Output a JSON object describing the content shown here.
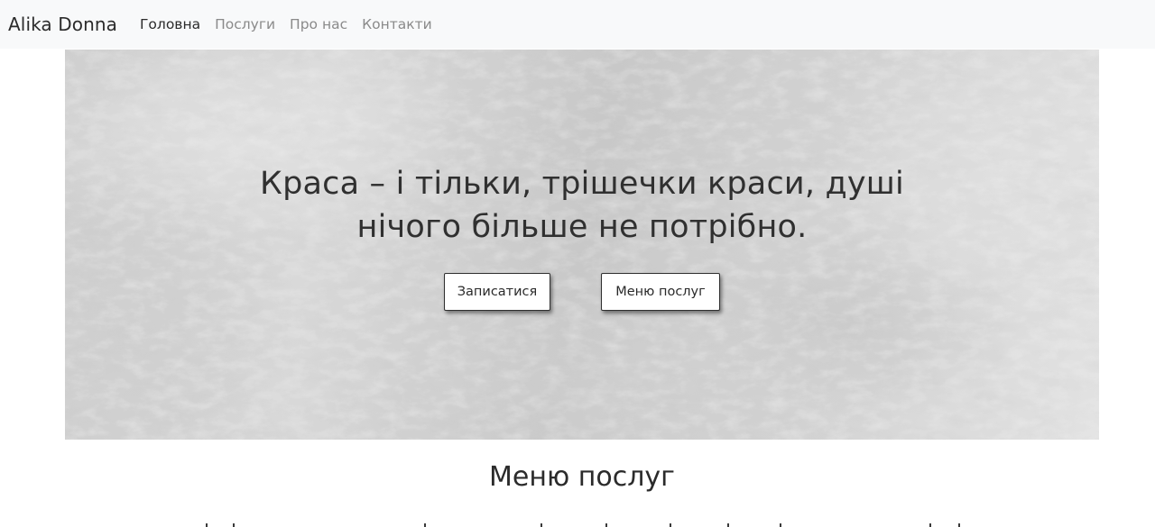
{
  "navbar": {
    "brand": "Alika Donna",
    "links": [
      {
        "label": "Головна",
        "active": true
      },
      {
        "label": "Послуги",
        "active": false
      },
      {
        "label": "Про нас",
        "active": false
      },
      {
        "label": "Контакти",
        "active": false
      }
    ]
  },
  "hero": {
    "title_line1": "Краса – і тільки, трішечки краси, душі",
    "title_line2": "нічого більше не потрібно.",
    "book_button": "Записатися",
    "menu_button": "Меню послуг"
  },
  "services": {
    "title": "Меню послуг"
  },
  "colors": {
    "navbar_bg": "#f8f9fa",
    "active_link": "#2b2b2b",
    "inactive_link": "#8a8a8a",
    "button_bg": "#ffffff"
  }
}
